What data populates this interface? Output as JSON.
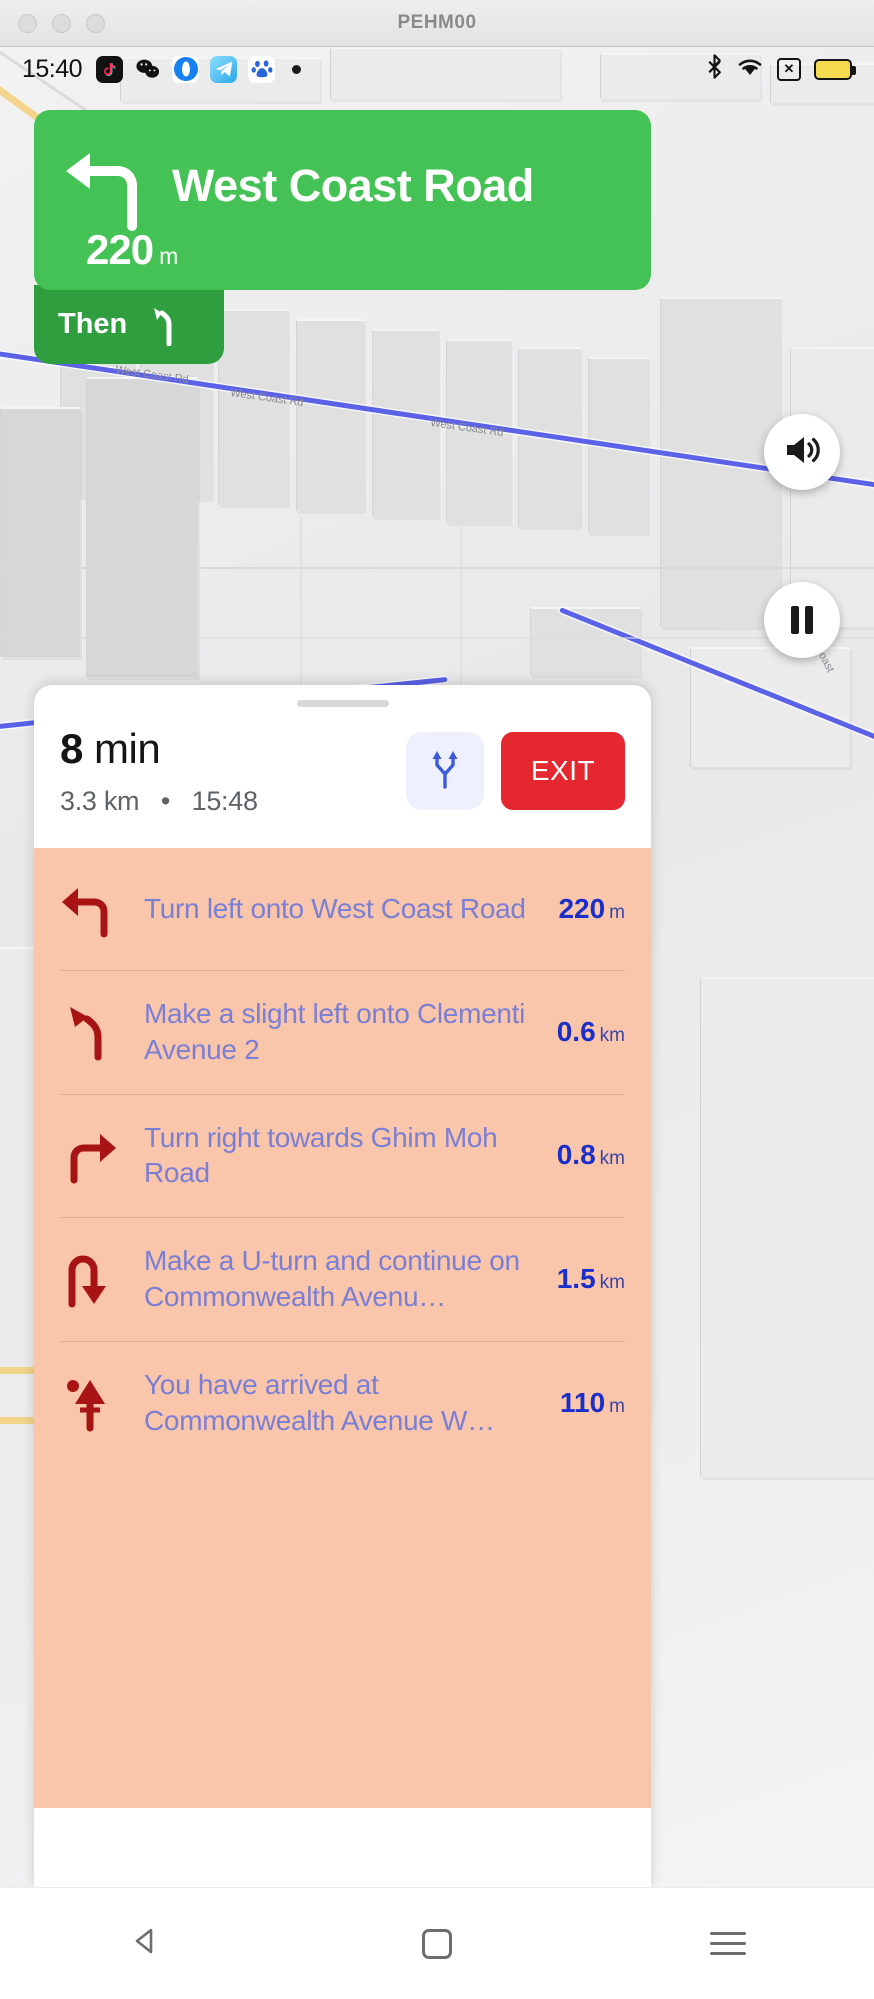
{
  "window": {
    "title": "PEHM00",
    "traffic_lights": [
      "close",
      "minimize",
      "maximize"
    ]
  },
  "status_bar": {
    "time": "15:40",
    "app_icons": [
      "tiktok-icon",
      "wechat-icon",
      "browser-icon",
      "telegram-icon",
      "baidu-icon"
    ],
    "camera_dot": "camera-punch-hole",
    "right_icons": [
      "bluetooth-icon",
      "wifi-icon",
      "no-sim-icon",
      "battery-icon"
    ]
  },
  "banner": {
    "street": "West Coast Road",
    "distance": "220",
    "distance_unit": "m",
    "maneuver_icon": "turn-left-arrow",
    "color": "#45c255",
    "then_label": "Then",
    "then_icon": "slight-left-arrow",
    "then_color": "#2e9e3e"
  },
  "map_controls": {
    "sound_icon": "speaker-icon",
    "pause_icon": "pause-icon"
  },
  "map": {
    "labels": [
      "West Coast Rd",
      "West Coast Rd",
      "West Coast Rd",
      "W Coast"
    ],
    "route_color": "#5b62e8"
  },
  "eta": {
    "minutes": "8",
    "minutes_unit": "min",
    "distance": "3.3 km",
    "separator": "•",
    "arrival_time": "15:48",
    "routes_icon": "alternate-routes-icon",
    "exit_label": "EXIT",
    "exit_color": "#e5282f"
  },
  "directions": {
    "background": "#f9c5ab",
    "text_color": "#7b7fd4",
    "distance_color": "#1a2ecb",
    "steps": [
      {
        "icon": "turn-left-icon",
        "text": "Turn left onto West Coast Road",
        "distance": "220",
        "unit": "m"
      },
      {
        "icon": "slight-left-icon",
        "text": "Make a slight left onto Clementi Avenue 2",
        "distance": "0.6",
        "unit": "km"
      },
      {
        "icon": "turn-right-icon",
        "text": "Turn right towards Ghim Moh Road",
        "distance": "0.8",
        "unit": "km"
      },
      {
        "icon": "u-turn-icon",
        "text": "Make a U-turn and continue on Commonwealth Avenu…",
        "distance": "1.5",
        "unit": "km"
      },
      {
        "icon": "destination-icon",
        "text": "You have arrived at Commonwealth Avenue W…",
        "distance": "110",
        "unit": "m"
      }
    ]
  },
  "nav_bar": {
    "back": "back-triangle-icon",
    "home": "home-square-icon",
    "recents": "menu-lines-icon"
  }
}
